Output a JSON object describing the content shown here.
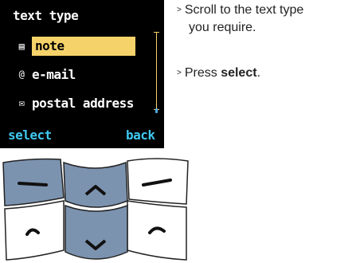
{
  "screen": {
    "title": "text type",
    "items": [
      {
        "icon": "note-icon",
        "label": "note",
        "selected": true
      },
      {
        "icon": "email-icon",
        "label": "e-mail",
        "selected": false
      },
      {
        "icon": "envelope-icon",
        "label": "postal address",
        "selected": false
      }
    ],
    "softkeys": {
      "left": "select",
      "right": "back"
    }
  },
  "instructions": {
    "step1_line1": "Scroll to the text type",
    "step1_line2": "you require.",
    "step2_prefix": "Press ",
    "step2_bold": "select",
    "step2_suffix": ".",
    "marker": ">"
  },
  "colors": {
    "highlight": "#f5d26a",
    "softkey": "#3fc8f0",
    "key_blue": "#7c93b0"
  }
}
